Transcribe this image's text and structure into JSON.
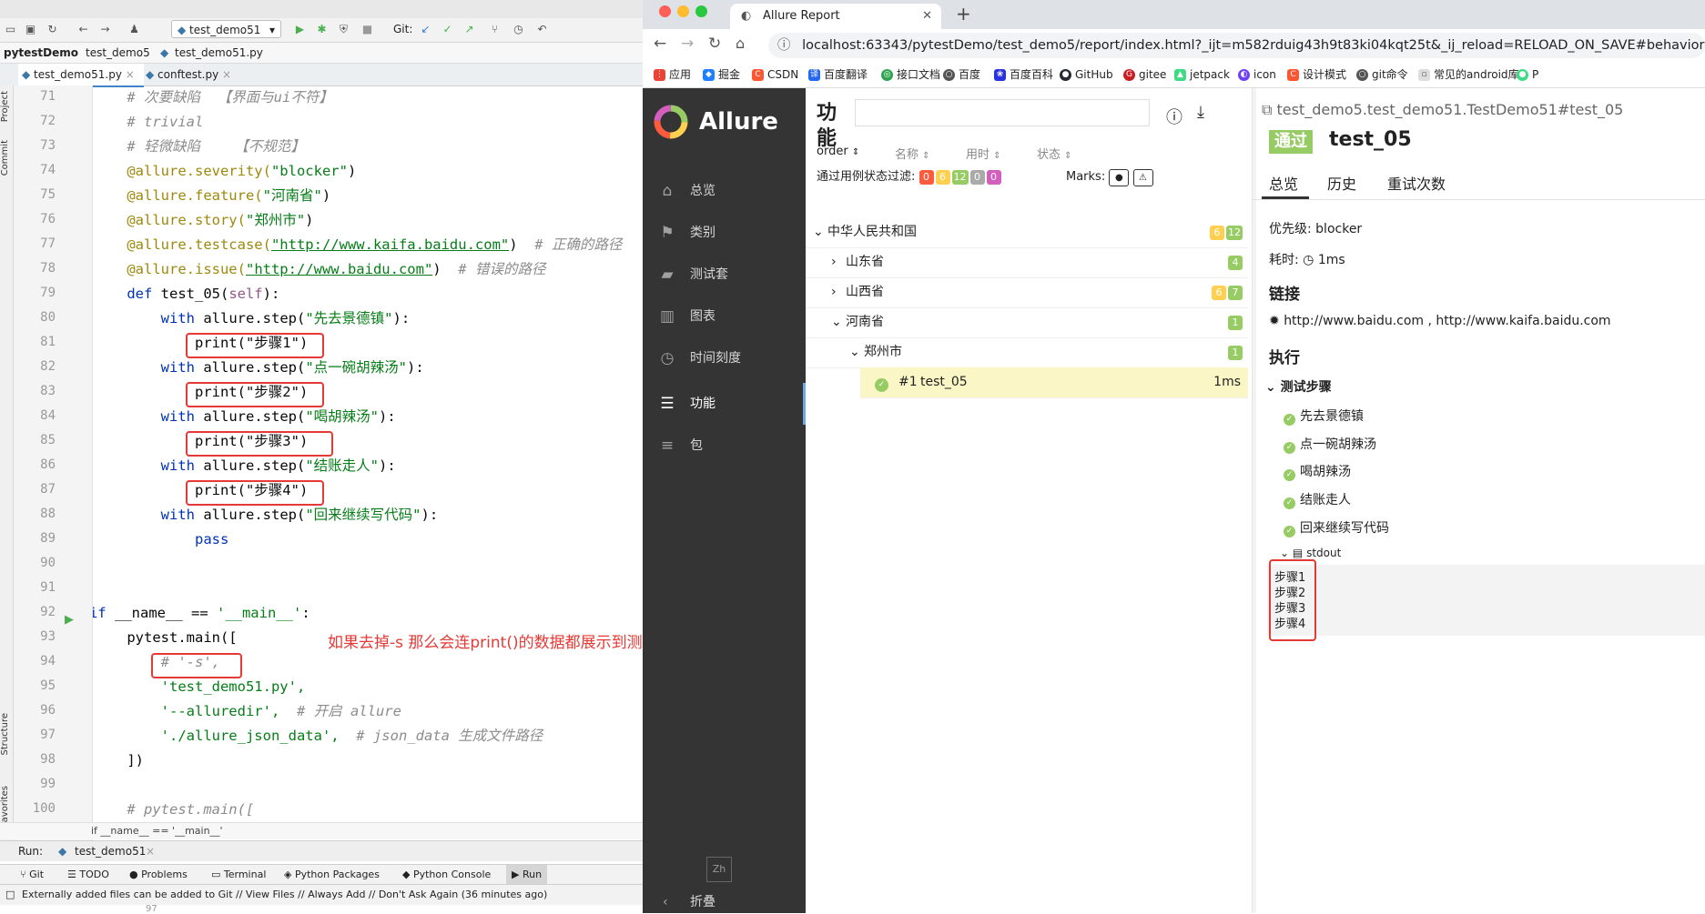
{
  "ide": {
    "project": "pytestDemo",
    "crumb_folder": "test_demo5",
    "crumb_file": "test_demo51.py",
    "run_config": "test_demo51",
    "git_label": "Git:",
    "tabs": [
      "test_demo51.py",
      "conftest.py"
    ],
    "side_labels": [
      "Project",
      "Commit",
      "Structure",
      "Favorites"
    ],
    "lines": [
      71,
      72,
      73,
      74,
      75,
      76,
      77,
      78,
      79,
      80,
      81,
      82,
      83,
      84,
      85,
      86,
      87,
      88,
      89,
      90,
      91,
      92,
      93,
      94,
      95,
      96,
      97,
      98,
      99,
      100
    ],
    "code": {
      "c71": "    # 次要缺陷  【界面与ui不符】",
      "c72": "    # trivial",
      "c73": "    # 轻微缺陷    【不规范】",
      "c74a": "    @allure.severity(",
      "c74b": "\"blocker\"",
      "c74c": ")",
      "c75a": "    @allure.feature(",
      "c75b": "\"河南省\"",
      "c75c": ")",
      "c76a": "    @allure.story(",
      "c76b": "\"郑州市\"",
      "c76c": ")",
      "c77a": "    @allure.testcase(",
      "c77b": "\"http://www.kaifa.baidu.com\"",
      "c77c": ")  ",
      "c77d": "# 正确的路径",
      "c78a": "    @allure.issue(",
      "c78b": "\"http://www.baidu.com\"",
      "c78c": ")  ",
      "c78d": "# 错误的路径",
      "c79a": "    def ",
      "c79b": "test_05(",
      "c79c": "self",
      "c79d": "):",
      "c80a": "        with ",
      "c80b": "allure.step(",
      "c80c": "\"先去景德镇\"",
      "c80d": "):",
      "c81": "            print(\"步骤1\")",
      "c82a": "        with ",
      "c82b": "allure.step(",
      "c82c": "\"点一碗胡辣汤\"",
      "c82d": "):",
      "c83": "            print(\"步骤2\")",
      "c84a": "        with ",
      "c84b": "allure.step(",
      "c84c": "\"喝胡辣汤\"",
      "c84d": "):",
      "c85": "            print(\"步骤3\")",
      "c86a": "        with ",
      "c86b": "allure.step(",
      "c86c": "\"结账走人\"",
      "c86d": "):",
      "c87": "            print(\"步骤4\")",
      "c88a": "        with ",
      "c88b": "allure.step(",
      "c88c": "\"回来继续写代码\"",
      "c88d": "):",
      "c89": "            pass",
      "c92a": "if ",
      "c92b": "__name__ == ",
      "c92c": "'__main__'",
      "c92d": ":",
      "c93": "    pytest.main([",
      "c94": "        # '-s',",
      "c95": "        'test_demo51.py',",
      "c96a": "        '--alluredir',  ",
      "c96b": "# 开启 allure",
      "c97a": "        './allure_json_data',  ",
      "c97b": "# json_data 生成文件路径",
      "c98": "    ])",
      "c100": "    # pytest.main(["
    },
    "annotation": "如果去掉-s 那么会连print()的数据都展示到测试报告中!",
    "hint": "if __name__ == '__main__'",
    "run_label": "Run:",
    "run_tab": "test_demo51",
    "tool_tabs": [
      "Git",
      "TODO",
      "Problems",
      "Terminal",
      "Python Packages",
      "Python Console",
      "Run"
    ],
    "status": "Externally added files can be added to Git // View Files // Always Add // Don't Ask Again (36 minutes ago)",
    "status_line_no": "97"
  },
  "browser": {
    "tab_title": "Allure Report",
    "url": "localhost:63343/pytestDemo/test_demo5/report/index.html?_ijt=m582rduig43h9t83ki04kqt25t&_ij_reload=RELOAD_ON_SAVE#behaviors/213239137",
    "bookmarks": [
      "应用",
      "掘金",
      "CSDN",
      "百度翻译",
      "接口文档",
      "百度",
      "百度百科",
      "GitHub",
      "gitee",
      "jetpack",
      "icon",
      "设计模式",
      "git命令",
      "常见的android库",
      "P"
    ]
  },
  "allure": {
    "brand": "Allure",
    "nav": [
      "总览",
      "类别",
      "测试套",
      "图表",
      "时间刻度",
      "功能",
      "包"
    ],
    "lang": "Zh",
    "collapse": "折叠",
    "panel_title_1": "功",
    "panel_title_2": "能",
    "sort": [
      "order",
      "名称",
      "用时",
      "状态"
    ],
    "filter_label": "通过用例状态过滤:",
    "filter_counts": [
      "0",
      "6",
      "12",
      "0",
      "0"
    ],
    "marks_label": "Marks:",
    "tree": [
      {
        "label": "中华人民共和国",
        "b1": "6",
        "b2": "12"
      },
      {
        "label": "山东省",
        "b2": "4"
      },
      {
        "label": "山西省",
        "b1": "6",
        "b2": "7"
      },
      {
        "label": "河南省",
        "b2": "1"
      },
      {
        "label": "郑州市",
        "b2": "1"
      }
    ],
    "case": {
      "num": "#1",
      "name": "test_05",
      "time": "1ms"
    },
    "detail": {
      "path": "test_demo5.test_demo51.TestDemo51#test_05",
      "status": "通过",
      "name": "test_05",
      "tabs": [
        "总览",
        "历史",
        "重试次数"
      ],
      "priority": "优先级: blocker",
      "duration_label": "耗时:",
      "duration": "1ms",
      "links_title": "链接",
      "links": "http://www.baidu.com , http://www.kaifa.baidu.com",
      "exec_title": "执行",
      "steps_title": "测试步骤",
      "steps": [
        "先去景德镇",
        "点一碗胡辣汤",
        "喝胡辣汤",
        "结账走人",
        "回来继续写代码"
      ],
      "stdout_label": "stdout",
      "stdout": [
        "步骤1",
        "步骤2",
        "步骤3",
        "步骤4"
      ]
    }
  },
  "colors": {
    "passed": "#97cc64",
    "broken": "#ffd050",
    "failed": "#fd5a3e",
    "skipped": "#aaaaaa",
    "unknown": "#d35ebe",
    "highlight": "#e53935",
    "allure_side": "#343434"
  }
}
